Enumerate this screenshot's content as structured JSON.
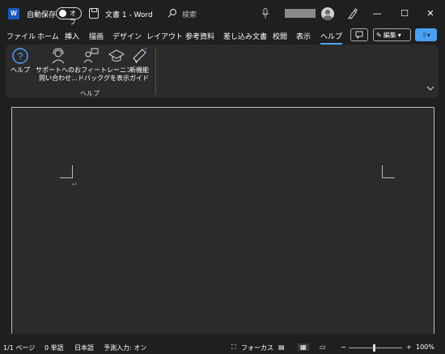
{
  "title_bar": {
    "app_logo": "W",
    "autosave_label": "自動保存",
    "autosave_state": "オフ",
    "document_title": "文書 1  -  Word",
    "search_placeholder": "検索",
    "icons": [
      "word-logo-icon",
      "save-icon",
      "search-icon",
      "microphone-icon",
      "avatar",
      "pen-icon",
      "minimize-icon",
      "maximize-icon",
      "close-icon"
    ]
  },
  "window_controls": {
    "minimize": "—",
    "maximize": "☐",
    "close": "✕"
  },
  "ribbon_tabs": [
    {
      "label": "ファイル",
      "active": false
    },
    {
      "label": "ホーム",
      "active": false
    },
    {
      "label": "挿入",
      "active": false
    },
    {
      "label": "描画",
      "active": false
    },
    {
      "label": "デザイン",
      "active": false
    },
    {
      "label": "レイアウト",
      "active": false
    },
    {
      "label": "参考資料",
      "active": false
    },
    {
      "label": "差し込み文書",
      "active": false
    },
    {
      "label": "校閲",
      "active": false
    },
    {
      "label": "表示",
      "active": false
    },
    {
      "label": "ヘルプ",
      "active": true
    }
  ],
  "right_controls": {
    "edit_label": "編集"
  },
  "ribbon": {
    "group_label": "ヘルプ",
    "items": [
      {
        "line1": "ヘルプ",
        "line2": "",
        "icon": "help-icon"
      },
      {
        "line1": "サポートへのお",
        "line2": "問い合わせ...",
        "icon": "support-headset-icon"
      },
      {
        "line1": "フィー",
        "line2": "ドバック",
        "icon": "feedback-icon"
      },
      {
        "line1": "トレーニン",
        "line2": "グを表示",
        "icon": "training-mortarboard-icon"
      },
      {
        "line1": "新機能",
        "line2": "ガイド",
        "icon": "megaphone-icon"
      }
    ]
  },
  "document": {
    "paragraph_mark": "↵"
  },
  "status_bar": {
    "page": "1/1 ページ",
    "words": "0 単語",
    "language": "日本語",
    "predictive": "予測入力: オン",
    "focus": "フォーカス",
    "zoom_level": "100%",
    "zoom_minus": "−",
    "zoom_plus": "+"
  },
  "colors": {
    "accent": "#4fa3ff",
    "share_button": "#4aa0f0",
    "word_logo": "#185abd",
    "background": "#1f1f1f",
    "page": "#2b2b2b"
  }
}
